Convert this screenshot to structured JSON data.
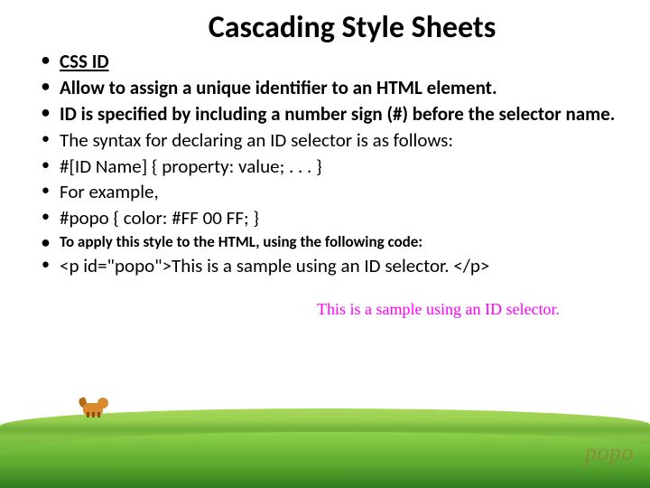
{
  "title": "Cascading Style Sheets",
  "bullets": [
    "CSS ID",
    "Allow to assign a unique identifier to an HTML element.",
    "ID is specified by including a number sign (#) before the selector name.",
    "The syntax for declaring an ID selector is as follows:",
    "#[ID Name] {   property: value;   . . . }",
    "For example,",
    "#popo { color: #FF 00 FF; }",
    "To apply this style to the HTML, using the following code:",
    "<p id=\"popo\">This is a sample using an ID selector. </p>"
  ],
  "sample_output": "This is a sample using an ID selector.",
  "watermark": "popo"
}
